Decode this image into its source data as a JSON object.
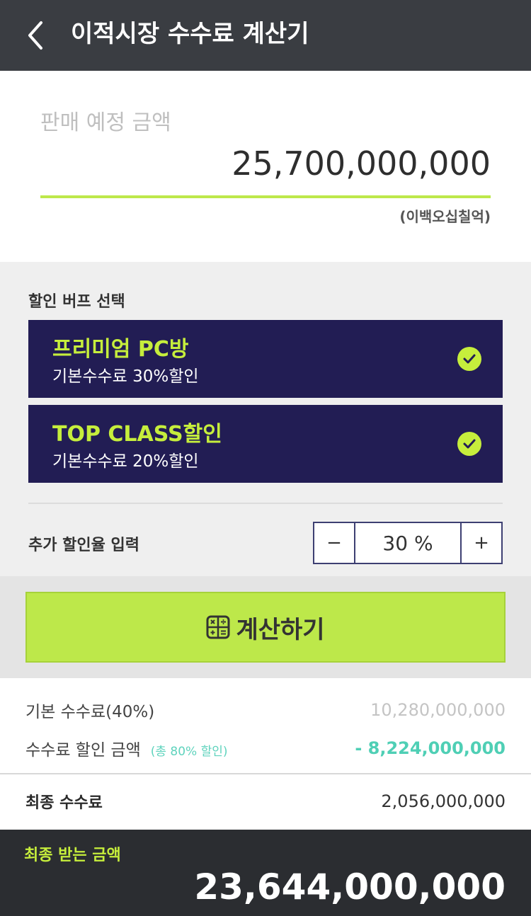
{
  "header": {
    "title": "이적시장 수수료 계산기",
    "back_icon": "chevron-left-icon"
  },
  "sale": {
    "label": "판매 예정 금액",
    "amount": "25,700,000,000",
    "amount_korean": "(이백오십칠억)"
  },
  "buff": {
    "title": "할인 버프 선택",
    "options": [
      {
        "name": "프리미엄 PC방",
        "description": "기본수수료 30%할인",
        "checked": true
      },
      {
        "name": "TOP CLASS할인",
        "description": "기본수수료 20%할인",
        "checked": true
      }
    ],
    "extra_label": "추가 할인율 입력",
    "stepper": {
      "minus": "−",
      "value": "30 %",
      "plus": "+"
    }
  },
  "calculate": {
    "label": "계산하기",
    "icon": "calculator-icon"
  },
  "results": {
    "base_fee_label": "기본 수수료(40%)",
    "base_fee_value": "10,280,000,000",
    "discount_label": "수수료 할인 금액",
    "discount_sub": "(총 80% 할인)",
    "discount_value": "- 8,224,000,000",
    "final_fee_label": "최종 수수료",
    "final_fee_value": "2,056,000,000"
  },
  "footer": {
    "label": "최종 받는 금액",
    "amount": "23,644,000,000"
  },
  "colors": {
    "header_bg": "#3a3d42",
    "accent_green": "#bde84a",
    "card_navy": "#221d54",
    "teal": "#4fcfb5",
    "footer_bg": "#2b2d31"
  }
}
